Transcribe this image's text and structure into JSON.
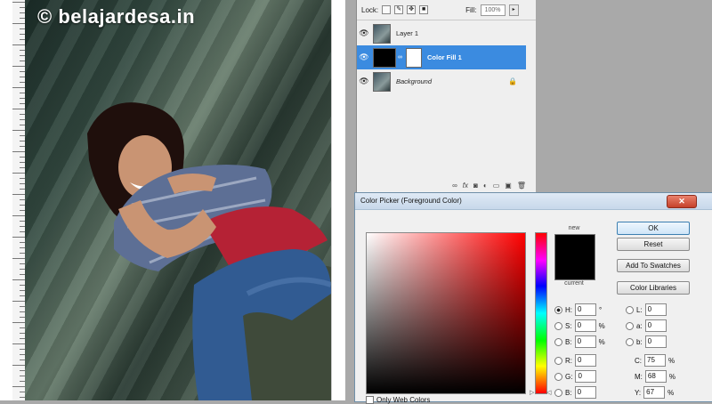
{
  "watermark": "© belajardesa.in",
  "layers_panel": {
    "lock_label": "Lock:",
    "fill_label": "Fill:",
    "fill_value": "100%",
    "layers": [
      {
        "name": "Layer 1",
        "selected": false
      },
      {
        "name": "Color Fill 1",
        "selected": true
      },
      {
        "name": "Background",
        "selected": false
      }
    ],
    "bottom_icons": [
      "link-icon",
      "fx-icon",
      "mask-icon",
      "adjustment-icon",
      "group-icon",
      "new-layer-icon",
      "trash-icon"
    ]
  },
  "color_picker": {
    "title": "Color Picker (Foreground Color)",
    "close_symbol": "✕",
    "new_label": "new",
    "current_label": "current",
    "new_color": "#000000",
    "buttons": {
      "ok": "OK",
      "reset": "Reset",
      "add_to_swatches": "Add To Swatches",
      "color_libraries": "Color Libraries"
    },
    "fields": {
      "H": {
        "label": "H:",
        "value": "0",
        "unit": "°"
      },
      "S": {
        "label": "S:",
        "value": "0",
        "unit": "%"
      },
      "Bv": {
        "label": "B:",
        "value": "0",
        "unit": "%"
      },
      "R": {
        "label": "R:",
        "value": "0"
      },
      "G": {
        "label": "G:",
        "value": "0"
      },
      "Bl": {
        "label": "B:",
        "value": "0"
      },
      "L": {
        "label": "L:",
        "value": "0"
      },
      "a": {
        "label": "a:",
        "value": "0"
      },
      "b": {
        "label": "b:",
        "value": "0"
      },
      "C": {
        "label": "C:",
        "value": "75",
        "unit": "%"
      },
      "M": {
        "label": "M:",
        "value": "68",
        "unit": "%"
      },
      "Y": {
        "label": "Y:",
        "value": "67",
        "unit": "%"
      }
    },
    "only_web_colors": "Only Web Colors"
  }
}
